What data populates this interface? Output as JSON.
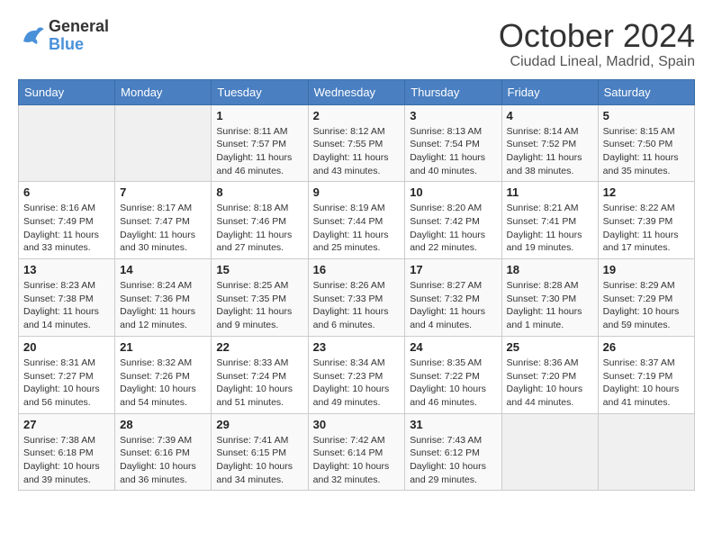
{
  "header": {
    "logo_line1": "General",
    "logo_line2": "Blue",
    "month": "October 2024",
    "location": "Ciudad Lineal, Madrid, Spain"
  },
  "columns": [
    "Sunday",
    "Monday",
    "Tuesday",
    "Wednesday",
    "Thursday",
    "Friday",
    "Saturday"
  ],
  "weeks": [
    {
      "days": [
        {
          "num": "",
          "empty": true
        },
        {
          "num": "",
          "empty": true
        },
        {
          "num": "1",
          "sunrise": "Sunrise: 8:11 AM",
          "sunset": "Sunset: 7:57 PM",
          "daylight": "Daylight: 11 hours and 46 minutes."
        },
        {
          "num": "2",
          "sunrise": "Sunrise: 8:12 AM",
          "sunset": "Sunset: 7:55 PM",
          "daylight": "Daylight: 11 hours and 43 minutes."
        },
        {
          "num": "3",
          "sunrise": "Sunrise: 8:13 AM",
          "sunset": "Sunset: 7:54 PM",
          "daylight": "Daylight: 11 hours and 40 minutes."
        },
        {
          "num": "4",
          "sunrise": "Sunrise: 8:14 AM",
          "sunset": "Sunset: 7:52 PM",
          "daylight": "Daylight: 11 hours and 38 minutes."
        },
        {
          "num": "5",
          "sunrise": "Sunrise: 8:15 AM",
          "sunset": "Sunset: 7:50 PM",
          "daylight": "Daylight: 11 hours and 35 minutes."
        }
      ]
    },
    {
      "days": [
        {
          "num": "6",
          "sunrise": "Sunrise: 8:16 AM",
          "sunset": "Sunset: 7:49 PM",
          "daylight": "Daylight: 11 hours and 33 minutes."
        },
        {
          "num": "7",
          "sunrise": "Sunrise: 8:17 AM",
          "sunset": "Sunset: 7:47 PM",
          "daylight": "Daylight: 11 hours and 30 minutes."
        },
        {
          "num": "8",
          "sunrise": "Sunrise: 8:18 AM",
          "sunset": "Sunset: 7:46 PM",
          "daylight": "Daylight: 11 hours and 27 minutes."
        },
        {
          "num": "9",
          "sunrise": "Sunrise: 8:19 AM",
          "sunset": "Sunset: 7:44 PM",
          "daylight": "Daylight: 11 hours and 25 minutes."
        },
        {
          "num": "10",
          "sunrise": "Sunrise: 8:20 AM",
          "sunset": "Sunset: 7:42 PM",
          "daylight": "Daylight: 11 hours and 22 minutes."
        },
        {
          "num": "11",
          "sunrise": "Sunrise: 8:21 AM",
          "sunset": "Sunset: 7:41 PM",
          "daylight": "Daylight: 11 hours and 19 minutes."
        },
        {
          "num": "12",
          "sunrise": "Sunrise: 8:22 AM",
          "sunset": "Sunset: 7:39 PM",
          "daylight": "Daylight: 11 hours and 17 minutes."
        }
      ]
    },
    {
      "days": [
        {
          "num": "13",
          "sunrise": "Sunrise: 8:23 AM",
          "sunset": "Sunset: 7:38 PM",
          "daylight": "Daylight: 11 hours and 14 minutes."
        },
        {
          "num": "14",
          "sunrise": "Sunrise: 8:24 AM",
          "sunset": "Sunset: 7:36 PM",
          "daylight": "Daylight: 11 hours and 12 minutes."
        },
        {
          "num": "15",
          "sunrise": "Sunrise: 8:25 AM",
          "sunset": "Sunset: 7:35 PM",
          "daylight": "Daylight: 11 hours and 9 minutes."
        },
        {
          "num": "16",
          "sunrise": "Sunrise: 8:26 AM",
          "sunset": "Sunset: 7:33 PM",
          "daylight": "Daylight: 11 hours and 6 minutes."
        },
        {
          "num": "17",
          "sunrise": "Sunrise: 8:27 AM",
          "sunset": "Sunset: 7:32 PM",
          "daylight": "Daylight: 11 hours and 4 minutes."
        },
        {
          "num": "18",
          "sunrise": "Sunrise: 8:28 AM",
          "sunset": "Sunset: 7:30 PM",
          "daylight": "Daylight: 11 hours and 1 minute."
        },
        {
          "num": "19",
          "sunrise": "Sunrise: 8:29 AM",
          "sunset": "Sunset: 7:29 PM",
          "daylight": "Daylight: 10 hours and 59 minutes."
        }
      ]
    },
    {
      "days": [
        {
          "num": "20",
          "sunrise": "Sunrise: 8:31 AM",
          "sunset": "Sunset: 7:27 PM",
          "daylight": "Daylight: 10 hours and 56 minutes."
        },
        {
          "num": "21",
          "sunrise": "Sunrise: 8:32 AM",
          "sunset": "Sunset: 7:26 PM",
          "daylight": "Daylight: 10 hours and 54 minutes."
        },
        {
          "num": "22",
          "sunrise": "Sunrise: 8:33 AM",
          "sunset": "Sunset: 7:24 PM",
          "daylight": "Daylight: 10 hours and 51 minutes."
        },
        {
          "num": "23",
          "sunrise": "Sunrise: 8:34 AM",
          "sunset": "Sunset: 7:23 PM",
          "daylight": "Daylight: 10 hours and 49 minutes."
        },
        {
          "num": "24",
          "sunrise": "Sunrise: 8:35 AM",
          "sunset": "Sunset: 7:22 PM",
          "daylight": "Daylight: 10 hours and 46 minutes."
        },
        {
          "num": "25",
          "sunrise": "Sunrise: 8:36 AM",
          "sunset": "Sunset: 7:20 PM",
          "daylight": "Daylight: 10 hours and 44 minutes."
        },
        {
          "num": "26",
          "sunrise": "Sunrise: 8:37 AM",
          "sunset": "Sunset: 7:19 PM",
          "daylight": "Daylight: 10 hours and 41 minutes."
        }
      ]
    },
    {
      "days": [
        {
          "num": "27",
          "sunrise": "Sunrise: 7:38 AM",
          "sunset": "Sunset: 6:18 PM",
          "daylight": "Daylight: 10 hours and 39 minutes."
        },
        {
          "num": "28",
          "sunrise": "Sunrise: 7:39 AM",
          "sunset": "Sunset: 6:16 PM",
          "daylight": "Daylight: 10 hours and 36 minutes."
        },
        {
          "num": "29",
          "sunrise": "Sunrise: 7:41 AM",
          "sunset": "Sunset: 6:15 PM",
          "daylight": "Daylight: 10 hours and 34 minutes."
        },
        {
          "num": "30",
          "sunrise": "Sunrise: 7:42 AM",
          "sunset": "Sunset: 6:14 PM",
          "daylight": "Daylight: 10 hours and 32 minutes."
        },
        {
          "num": "31",
          "sunrise": "Sunrise: 7:43 AM",
          "sunset": "Sunset: 6:12 PM",
          "daylight": "Daylight: 10 hours and 29 minutes."
        },
        {
          "num": "",
          "empty": true
        },
        {
          "num": "",
          "empty": true
        }
      ]
    }
  ]
}
